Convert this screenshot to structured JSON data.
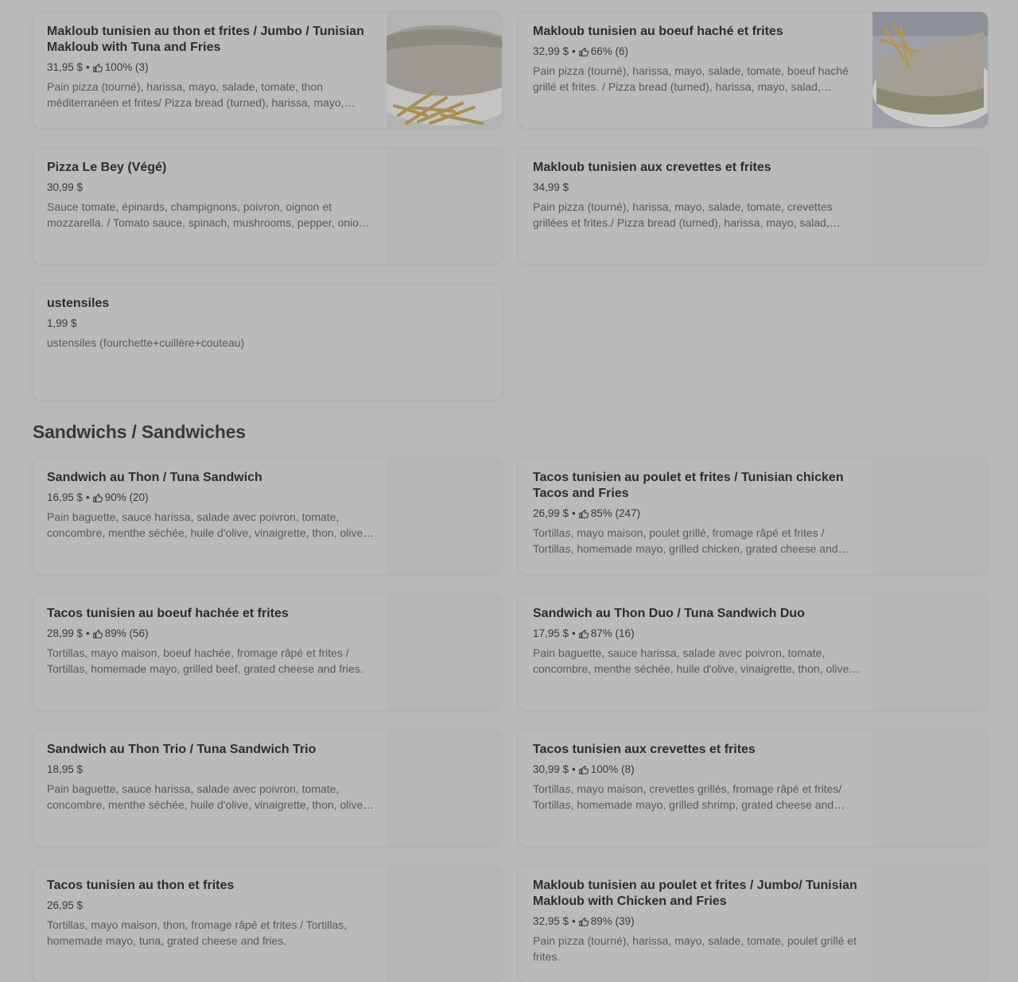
{
  "section": {
    "title": "Sandwichs / Sandwiches"
  },
  "items": [
    {
      "title": "Makloub tunisien au thon et frites  / Jumbo / Tunisian Makloub with Tuna and Fries",
      "price": "31,95 $",
      "rating": "100% (3)",
      "desc": "Pain pizza (tourné), harissa, mayo, salade, tomate, thon méditerranéen et frites/ Pizza bread (turned), harissa, mayo, salad, tomato, Mediterranean tuna and fries."
    },
    {
      "title": "Makloub tunisien au boeuf haché et frites",
      "price": "32,99 $",
      "rating": "66% (6)",
      "desc": "Pain pizza (tourné), harissa, mayo, salade, tomate, boeuf haché grillé et frites. / Pizza bread (turned), harissa, mayo, salad, tomato, grilled ground beef and fries."
    },
    {
      "title": "Pizza Le Bey (Végé)",
      "price": "30,99 $",
      "rating": "",
      "desc": "Sauce tomate, épinards, champignons, poivron, oignon et mozzarella. / Tomato sauce, spinach, mushrooms, pepper, onion and mozzarella."
    },
    {
      "title": "Makloub tunisien aux crevettes et frites",
      "price": "34,99 $",
      "rating": "",
      "desc": "Pain pizza (tourné), harissa, mayo, salade, tomate, crevettes grillées et frites./ Pizza bread (turned), harissa, mayo, salad, tomato, grilled shrimp and fries."
    },
    {
      "title": "ustensiles",
      "price": "1,99 $",
      "rating": "",
      "desc": "ustensiles (fourchette+cuillère+couteau)"
    },
    {
      "title": "Sandwich au Thon / Tuna Sandwich",
      "price": "16,95 $",
      "rating": "90% (20)",
      "desc": "Pain baguette, sauce harissa, salade avec poivron, tomate, concombre, menthe séchée, huile d'olive, vinaigrette, thon, olives et oeuf."
    },
    {
      "title": "Tacos tunisien au poulet et frites / Tunisian chicken Tacos and Fries",
      "price": "26,99 $",
      "rating": "85% (247)",
      "desc": "Tortillas, mayo maison, poulet grillé, fromage râpé et frites / Tortillas, homemade mayo, grilled chicken, grated cheese and fries."
    },
    {
      "title": "Tacos tunisien au boeuf hachée et frites",
      "price": "28,99 $",
      "rating": "89% (56)",
      "desc": "Tortillas, mayo maison, boeuf hachée, fromage râpé et frites / Tortillas, homemade mayo, grilled beef, grated cheese and fries."
    },
    {
      "title": "Sandwich au Thon Duo / Tuna Sandwich Duo",
      "price": "17,95 $",
      "rating": "87% (16)",
      "desc": "Pain baguette, sauce harissa, salade avec poivron, tomate, concombre, menthe séchée, huile d'olive, vinaigrette, thon, olives et oeuf."
    },
    {
      "title": "Sandwich au Thon Trio / Tuna Sandwich Trio",
      "price": "18,95 $",
      "rating": "",
      "desc": "Pain baguette, sauce harissa, salade avec poivron, tomate, concombre, menthe séchée, huile d'olive, vinaigrette, thon, olives et oeuf."
    },
    {
      "title": "Tacos tunisien aux crevettes et frites",
      "price": "30,99 $",
      "rating": "100% (8)",
      "desc": "Tortillas, mayo maison, crevettes grillés, fromage râpé et frites/ Tortillas, homemade mayo, grilled shrimp, grated cheese and fries."
    },
    {
      "title": "Tacos tunisien au thon et frites",
      "price": "26,95 $",
      "rating": "",
      "desc": "Tortillas, mayo maison, thon, fromage râpé et frites / Tortillas, homemade mayo, tuna, grated cheese and fries."
    },
    {
      "title": "Makloub tunisien au poulet et frites  / Jumbo/ Tunisian Makloub with Chicken and Fries",
      "price": "32,95 $",
      "rating": "89% (39)",
      "desc": "Pain pizza (tourné), harissa, mayo, salade, tomate, poulet grillé et frites."
    }
  ],
  "icons": {
    "rating": "thumbs-up-icon"
  },
  "separator": "•"
}
